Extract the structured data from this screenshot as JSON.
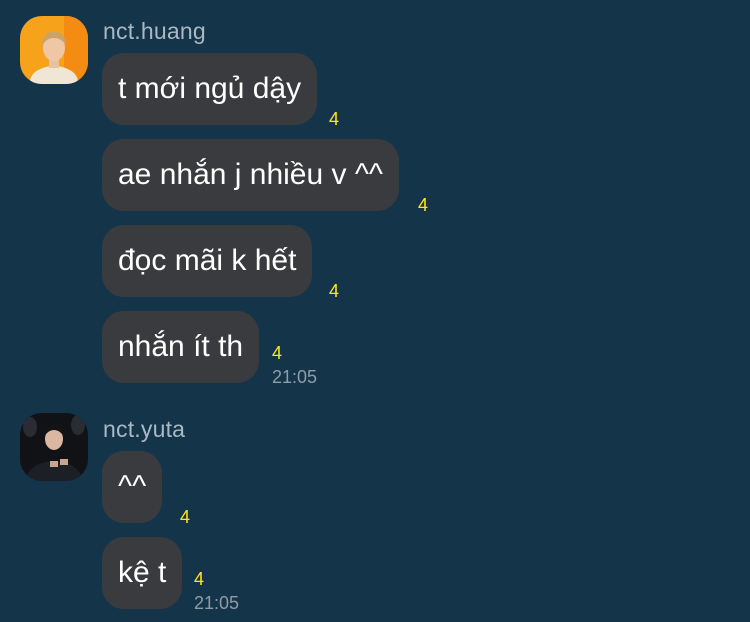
{
  "theme": {
    "background": "#14344a",
    "bubble": "#3a3b3e",
    "read_count_color": "#ffe818"
  },
  "groups": [
    {
      "sender": "nct.huang",
      "avatar": "avatar-photo-orange",
      "messages": [
        {
          "text": "t mới ngủ dậy",
          "read": "4"
        },
        {
          "text": "ae nhắn j nhiều v ^^",
          "read": "4"
        },
        {
          "text": "đọc mãi k hết",
          "read": "4"
        },
        {
          "text": "nhắn ít th",
          "read": "4",
          "time": "21:05"
        }
      ]
    },
    {
      "sender": "nct.yuta",
      "avatar": "avatar-photo-dark",
      "messages": [
        {
          "text": "^^",
          "read": "4"
        },
        {
          "text": "kệ t",
          "read": "4",
          "time": "21:05"
        }
      ]
    }
  ]
}
